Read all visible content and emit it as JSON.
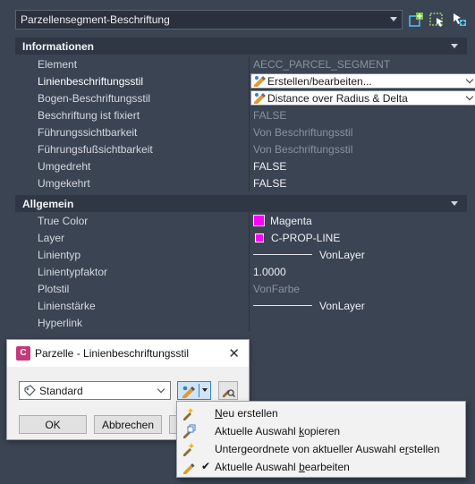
{
  "topbar": {
    "object_type": "Parzellensegment-Beschriftung",
    "icons": [
      "add-to-selection-icon",
      "quick-select-icon",
      "toggle-pickadd-icon"
    ]
  },
  "sections": {
    "info": {
      "title": "Informationen",
      "rows": [
        {
          "name": "Element",
          "value": "AECC_PARCEL_SEGMENT",
          "style": "dim"
        },
        {
          "name": "Linienbeschriftungsstil",
          "value": "Erstellen/bearbeiten...",
          "style": "combo"
        },
        {
          "name": "Bogen-Beschriftungsstil",
          "value": "Distance over Radius & Delta",
          "style": "combo"
        },
        {
          "name": "Beschriftung ist fixiert",
          "value": "FALSE",
          "style": "dim"
        },
        {
          "name": "Führungssichtbarkeit",
          "value": "Von Beschriftungsstil",
          "style": "dim"
        },
        {
          "name": "Führungsfußsichtbarkeit",
          "value": "Von Beschriftungsstil",
          "style": "dim"
        },
        {
          "name": "Umgedreht",
          "value": "FALSE",
          "style": "normal"
        },
        {
          "name": "Umgekehrt",
          "value": "FALSE",
          "style": "normal"
        }
      ]
    },
    "general": {
      "title": "Allgemein",
      "rows": [
        {
          "name": "True Color",
          "value": "Magenta"
        },
        {
          "name": "Layer",
          "value": "C-PROP-LINE"
        },
        {
          "name": "Linientyp",
          "value": "VonLayer"
        },
        {
          "name": "Linientypfaktor",
          "value": "1.0000"
        },
        {
          "name": "Plotstil",
          "value": "VonFarbe"
        },
        {
          "name": "Linienstärke",
          "value": "VonLayer"
        },
        {
          "name": "Hyperlink",
          "value": ""
        }
      ]
    }
  },
  "colors": {
    "magenta": "#ff00ff",
    "accent": "#3c7fc6",
    "panel": "#3b4453"
  },
  "dialog": {
    "app_icon_text": "C",
    "title": "Parzelle - Linienbeschriftungsstil",
    "close": "✕",
    "style_value": "Standard",
    "ok_label": "OK",
    "cancel_label": "Abbrechen"
  },
  "menu": {
    "items": [
      {
        "pre": "",
        "ul": "N",
        "post": "eu erstellen",
        "checked": false,
        "icon": "new-style-icon"
      },
      {
        "pre": "Aktuelle Auswahl ",
        "ul": "k",
        "post": "opieren",
        "checked": false,
        "icon": "copy-style-icon"
      },
      {
        "pre": "Untergeordnete von aktueller Auswahl e",
        "ul": "r",
        "post": "stellen",
        "checked": false,
        "icon": "child-style-icon"
      },
      {
        "pre": "Aktuelle Auswahl ",
        "ul": "b",
        "post": "earbeiten",
        "checked": true,
        "icon": "edit-style-icon"
      }
    ],
    "check_glyph": "✔"
  }
}
